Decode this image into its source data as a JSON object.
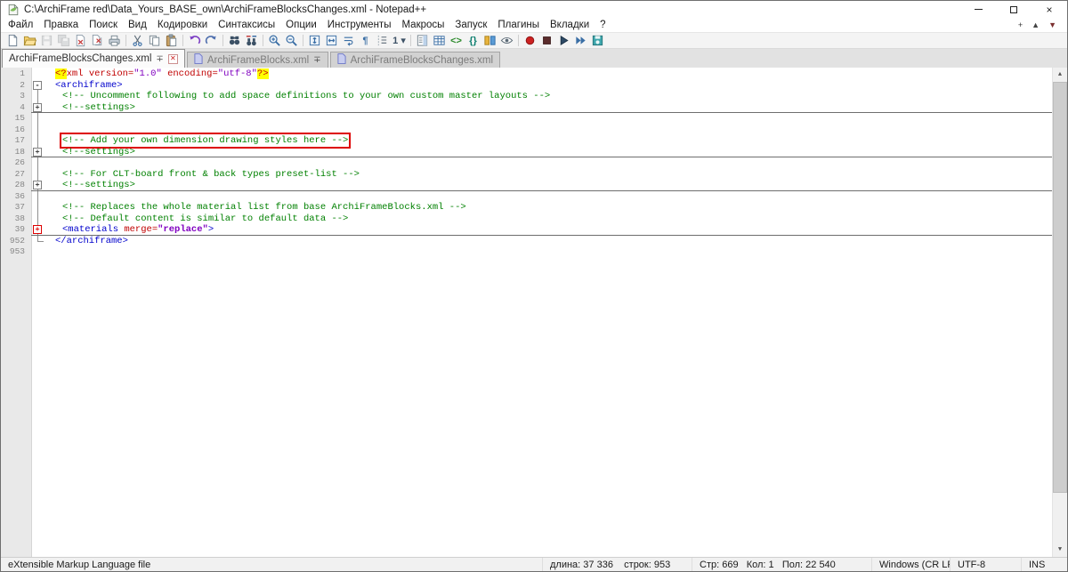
{
  "window": {
    "title": "C:\\ArchiFrame red\\Data_Yours_BASE_own\\ArchiFrameBlocksChanges.xml - Notepad++"
  },
  "menu_bar": {
    "items": [
      "Файл",
      "Правка",
      "Поиск",
      "Вид",
      "Кодировки",
      "Синтаксисы",
      "Опции",
      "Инструменты",
      "Макросы",
      "Запуск",
      "Плагины",
      "Вкладки",
      "?"
    ],
    "tab_controls": [
      {
        "name": "new-tab-button",
        "glyph": "+",
        "color": "#333333"
      },
      {
        "name": "tab-scroll-up-button",
        "glyph": "▲",
        "color": "#444444"
      },
      {
        "name": "tab-scroll-down-button",
        "glyph": "▼",
        "color": "#7b3030"
      }
    ]
  },
  "toolbar": {
    "buttons": [
      {
        "name": "new-file-button",
        "icon": "new-file"
      },
      {
        "name": "open-file-button",
        "icon": "open-folder"
      },
      {
        "name": "save-button",
        "icon": "save",
        "disabled": true
      },
      {
        "name": "save-all-button",
        "icon": "save-all",
        "disabled": true
      },
      {
        "name": "close-document-button",
        "icon": "close-doc"
      },
      {
        "name": "close-all-documents-button",
        "icon": "close-all"
      },
      {
        "name": "print-button",
        "icon": "print"
      },
      {
        "separator": true
      },
      {
        "name": "cut-button",
        "icon": "cut"
      },
      {
        "name": "copy-button",
        "icon": "copy"
      },
      {
        "name": "paste-button",
        "icon": "paste"
      },
      {
        "separator": true
      },
      {
        "name": "undo-button",
        "icon": "undo"
      },
      {
        "name": "redo-button",
        "icon": "redo"
      },
      {
        "separator": true
      },
      {
        "name": "find-button",
        "icon": "find"
      },
      {
        "name": "replace-button",
        "icon": "replace"
      },
      {
        "separator": true
      },
      {
        "name": "zoom-in-button",
        "icon": "zoom-in"
      },
      {
        "name": "zoom-out-button",
        "icon": "zoom-out"
      },
      {
        "separator": true
      },
      {
        "name": "sync-scroll-vertical-button",
        "icon": "sync-v"
      },
      {
        "name": "sync-scroll-horizontal-button",
        "icon": "sync-h"
      },
      {
        "name": "word-wrap-button",
        "icon": "word-wrap"
      },
      {
        "name": "show-all-characters-button",
        "icon": "pilcrow"
      },
      {
        "name": "indent-guide-button",
        "icon": "indent-guide"
      },
      {
        "name": "view-selector-dropdown",
        "icon": "view-dd"
      },
      {
        "separator": true
      },
      {
        "name": "document-map-plugin-button",
        "icon": "doc-map"
      },
      {
        "name": "grid-plugin-button",
        "icon": "grid"
      },
      {
        "name": "xml-tools-plugin-button",
        "icon": "xml"
      },
      {
        "name": "json-viewer-plugin-button",
        "icon": "braces"
      },
      {
        "name": "compare-plugin-button",
        "icon": "compare"
      },
      {
        "name": "spell-check-button",
        "icon": "eye"
      },
      {
        "separator": true
      },
      {
        "name": "record-macro-button",
        "icon": "record"
      },
      {
        "name": "stop-macro-button",
        "icon": "stop"
      },
      {
        "name": "playback-macro-button",
        "icon": "play"
      },
      {
        "name": "run-macro-multiple-button",
        "icon": "play-multi"
      },
      {
        "name": "save-macro-button",
        "icon": "save-macro"
      }
    ]
  },
  "tab_bar": {
    "tabs": [
      {
        "label": "ArchiFrameBlocksChanges.xml",
        "active": true,
        "doc_icon": false,
        "pin": true,
        "close": true
      },
      {
        "label": "ArchiFrameBlocks.xml",
        "active": false,
        "doc_icon": true,
        "pin": true,
        "close": false
      },
      {
        "label": "ArchiFrameBlocksChanges.xml",
        "active": false,
        "doc_icon": true,
        "pin": false,
        "close": false
      }
    ]
  },
  "editor": {
    "colors": {
      "tag": "#0000cc",
      "attr": "#c00000",
      "value": "#8000c0",
      "comment": "#008000",
      "plain": "#000000",
      "highlight": "#ffff00",
      "annotation_box": "#dd0000"
    },
    "lines": [
      {
        "num": "1",
        "fold": "none",
        "indent": 0,
        "segments": [
          {
            "text": "<?",
            "color": "attr",
            "hl": true
          },
          {
            "text": "xml ",
            "color": "attr"
          },
          {
            "text": "version=",
            "color": "attr"
          },
          {
            "text": "\"1.0\"",
            "color": "value"
          },
          {
            "text": " ",
            "color": "plain"
          },
          {
            "text": "encoding=",
            "color": "attr"
          },
          {
            "text": "\"utf-8\"",
            "color": "value"
          },
          {
            "text": "?>",
            "color": "attr",
            "hl": true
          }
        ]
      },
      {
        "num": "2",
        "fold": "open",
        "indent": 0,
        "segments": [
          {
            "text": "<archiframe>",
            "color": "tag"
          }
        ]
      },
      {
        "num": "3",
        "fold": "line",
        "indent": 1,
        "segments": [
          {
            "text": "<!-- Uncomment following to add space definitions to your own custom master layouts -->",
            "color": "comment"
          }
        ]
      },
      {
        "num": "4",
        "fold": "collapsed",
        "indent": 1,
        "hrule": true,
        "segments": [
          {
            "text": "<!--settings>",
            "color": "comment"
          }
        ]
      },
      {
        "num": "15",
        "fold": "line",
        "indent": 0,
        "segments": []
      },
      {
        "num": "16",
        "fold": "line",
        "indent": 0,
        "segments": []
      },
      {
        "num": "17",
        "fold": "line",
        "indent": 1,
        "boxed": true,
        "segments": [
          {
            "text": "<!-- Add your own dimension drawing styles here -->",
            "color": "comment"
          }
        ]
      },
      {
        "num": "18",
        "fold": "collapsed",
        "indent": 1,
        "hrule": true,
        "segments": [
          {
            "text": "<!--settings>",
            "color": "comment"
          }
        ]
      },
      {
        "num": "26",
        "fold": "line",
        "indent": 0,
        "segments": []
      },
      {
        "num": "27",
        "fold": "line",
        "indent": 1,
        "segments": [
          {
            "text": "<!-- For CLT-board front & back types preset-list -->",
            "color": "comment"
          }
        ]
      },
      {
        "num": "28",
        "fold": "collapsed",
        "indent": 1,
        "hrule": true,
        "segments": [
          {
            "text": "<!--settings>",
            "color": "comment"
          }
        ]
      },
      {
        "num": "36",
        "fold": "line",
        "indent": 0,
        "segments": []
      },
      {
        "num": "37",
        "fold": "line",
        "indent": 1,
        "segments": [
          {
            "text": "<!-- Replaces the whole material list from base ArchiFrameBlocks.xml -->",
            "color": "comment"
          }
        ]
      },
      {
        "num": "38",
        "fold": "line",
        "indent": 1,
        "segments": [
          {
            "text": "<!-- Default content is similar to default data -->",
            "color": "comment"
          }
        ]
      },
      {
        "num": "39",
        "fold": "collapsed-red",
        "indent": 1,
        "hrule": true,
        "segments": [
          {
            "text": "<materials ",
            "color": "tag"
          },
          {
            "text": "merge=",
            "color": "attr"
          },
          {
            "text": "\"replace\"",
            "color": "value",
            "bold": true
          },
          {
            "text": ">",
            "color": "tag"
          }
        ]
      },
      {
        "num": "952",
        "fold": "end",
        "indent": 0,
        "segments": [
          {
            "text": "</archiframe>",
            "color": "tag"
          }
        ]
      },
      {
        "num": "953",
        "fold": "none",
        "indent": 0,
        "segments": []
      }
    ]
  },
  "status_bar": {
    "doctype": "eXtensible Markup Language file",
    "length": "длина: 37 336    строк: 953",
    "position": "Стр: 669   Кол: 1   Пол: 22 540",
    "eol": "Windows (CR LF)",
    "encoding": "UTF-8",
    "insert_mode": "INS"
  }
}
